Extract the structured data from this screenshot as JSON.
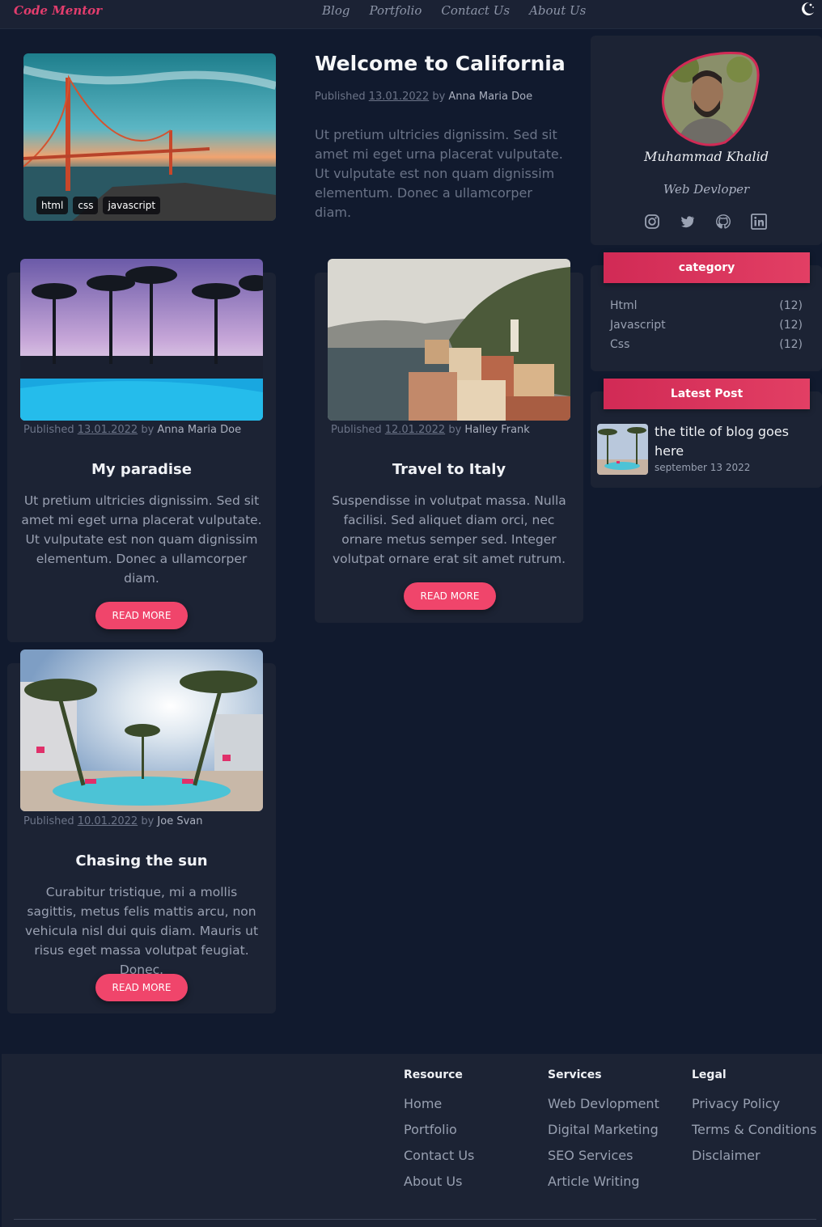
{
  "nav": {
    "brand": "Code Mentor",
    "links": [
      "Blog",
      "Portfolio",
      "Contact Us",
      "About Us"
    ],
    "theme_icon": "moon-icon"
  },
  "hero": {
    "title": "Welcome to California",
    "tags": [
      "html",
      "css",
      "javascript"
    ],
    "published_label": "Published",
    "date": "13.01.2022",
    "by_label": "by",
    "author": "Anna Maria Doe",
    "text": "Ut pretium ultricies dignissim. Sed sit amet mi eget urna placerat vulputate. Ut vulputate est non quam dignissim elementum. Donec a ullamcorper diam."
  },
  "posts": [
    {
      "published_label": "Published",
      "date": "13.01.2022",
      "by_label": "by",
      "author": "Anna Maria Doe",
      "title": "My paradise",
      "text": "Ut pretium ultricies dignissim. Sed sit amet mi eget urna placerat vulputate. Ut vulputate est non quam dignissim elementum. Donec a ullamcorper diam.",
      "button": "READ MORE"
    },
    {
      "published_label": "Published",
      "date": "12.01.2022",
      "by_label": "by",
      "author": "Halley Frank",
      "title": "Travel to Italy",
      "text": "Suspendisse in volutpat massa. Nulla facilisi. Sed aliquet diam orci, nec ornare metus semper sed. Integer volutpat ornare erat sit amet rutrum.",
      "button": "READ MORE"
    },
    {
      "published_label": "Published",
      "date": "10.01.2022",
      "by_label": "by",
      "author": "Joe Svan",
      "title": "Chasing the sun",
      "text": "Curabitur tristique, mi a mollis sagittis, metus felis mattis arcu, non vehicula nisl dui quis diam. Mauris ut risus eget massa volutpat feugiat. Donec.",
      "button": "READ MORE"
    }
  ],
  "profile": {
    "name": "Muhammad Khalid",
    "role": "Web Devloper",
    "socials": [
      "instagram-icon",
      "twitter-icon",
      "github-icon",
      "linkedin-icon"
    ]
  },
  "category": {
    "header": "category",
    "items": [
      {
        "label": "Html",
        "count": "(12)"
      },
      {
        "label": "Javascript",
        "count": "(12)"
      },
      {
        "label": "Css",
        "count": "(12)"
      }
    ]
  },
  "latest": {
    "header": "Latest Post",
    "title": "the title of blog goes here",
    "date": "september 13 2022"
  },
  "footer": {
    "columns": [
      {
        "heading": "Resource",
        "links": [
          "Home",
          "Portfolio",
          "Contact Us",
          "About Us"
        ]
      },
      {
        "heading": "Services",
        "links": [
          "Web Devlopment",
          "Digital Marketing",
          "SEO Services",
          "Article Writing"
        ]
      },
      {
        "heading": "Legal",
        "links": [
          "Privacy Policy",
          "Terms & Conditions",
          "Disclaimer"
        ]
      }
    ]
  },
  "colors": {
    "background": "#111a2e",
    "card": "#1c2334",
    "accent": "#f0456b",
    "brand": "#e23d6d"
  }
}
